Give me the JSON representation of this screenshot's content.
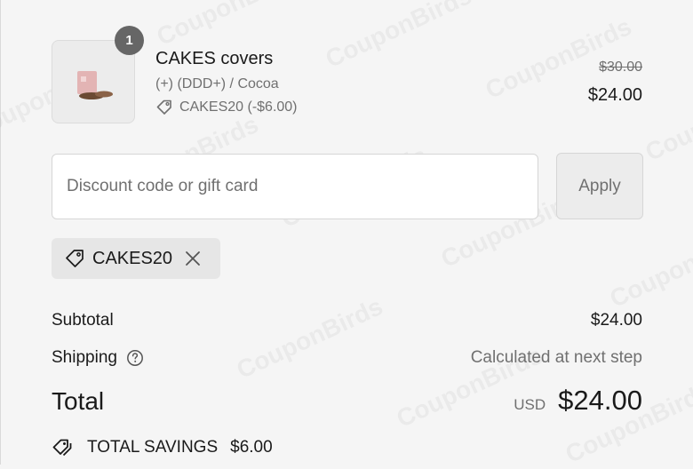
{
  "watermark_text": "CouponBirds",
  "product": {
    "quantity": "1",
    "name": "CAKES covers",
    "variant": "(+) (DDD+) / Cocoa",
    "discount_line": "CAKES20 (-$6.00)",
    "original_price": "$30.00",
    "final_price": "$24.00",
    "image_icon": "product-thumbnail"
  },
  "discount": {
    "placeholder": "Discount code or gift card",
    "value": "",
    "apply_label": "Apply",
    "applied_code": "CAKES20"
  },
  "summary": {
    "subtotal_label": "Subtotal",
    "subtotal_value": "$24.00",
    "shipping_label": "Shipping",
    "shipping_value": "Calculated at next step",
    "total_label": "Total",
    "total_currency": "USD",
    "total_value": "$24.00",
    "savings_label": "TOTAL SAVINGS",
    "savings_value": "$6.00"
  },
  "colors": {
    "background": "#f5f5f5",
    "text_primary": "#1a1a1a",
    "text_secondary": "#707070",
    "badge": "#666666",
    "chip": "#e6e6e6"
  }
}
